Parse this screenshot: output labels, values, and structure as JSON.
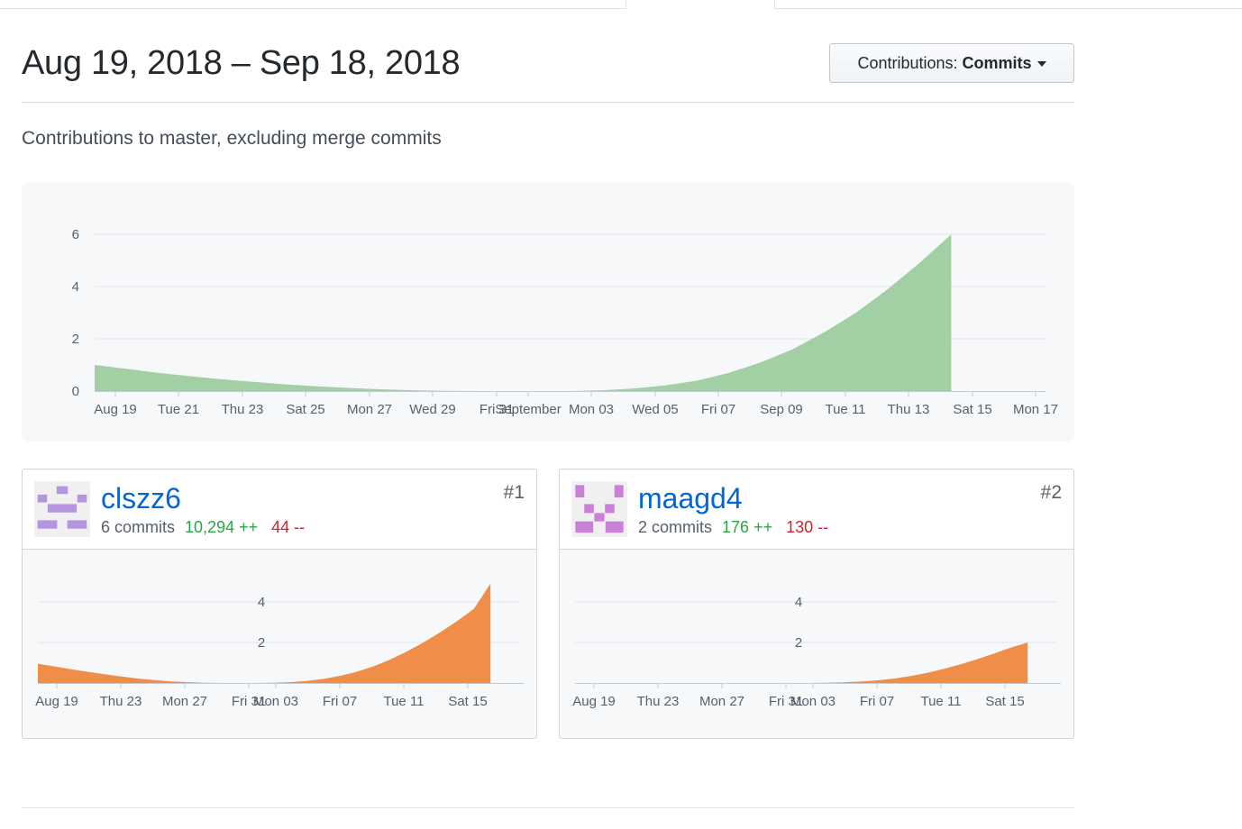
{
  "header": {
    "date_range": "Aug 19, 2018 – Sep 18, 2018",
    "contributions_label": "Contributions:",
    "contributions_value": "Commits"
  },
  "subtitle": "Contributions to master, excluding merge commits",
  "chart_data": [
    {
      "type": "area",
      "color": "#a2cfa4",
      "x_ticks": [
        "Aug 19",
        "Tue 21",
        "Thu 23",
        "Sat 25",
        "Mon 27",
        "Wed 29",
        "Fri 31",
        "September",
        "Mon 03",
        "Wed 05",
        "Fri 07",
        "Sep 09",
        "Tue 11",
        "Thu 13",
        "Sat 15",
        "Mon 17"
      ],
      "y_ticks": [
        0,
        2,
        4,
        6
      ],
      "ylim": [
        0,
        7
      ],
      "x": [
        "2018-08-19",
        "2018-08-20",
        "2018-08-21",
        "2018-08-22",
        "2018-08-23",
        "2018-08-24",
        "2018-08-25",
        "2018-08-26",
        "2018-08-27",
        "2018-08-28",
        "2018-08-29",
        "2018-08-30",
        "2018-08-31",
        "2018-09-01",
        "2018-09-02",
        "2018-09-03",
        "2018-09-04",
        "2018-09-05",
        "2018-09-06",
        "2018-09-07",
        "2018-09-08",
        "2018-09-09",
        "2018-09-10",
        "2018-09-11",
        "2018-09-12",
        "2018-09-13",
        "2018-09-14",
        "2018-09-15"
      ],
      "y": [
        1.0,
        0.85,
        0.7,
        0.57,
        0.45,
        0.35,
        0.26,
        0.18,
        0.12,
        0.07,
        0.03,
        0.01,
        0,
        0,
        0,
        0,
        0.03,
        0.1,
        0.22,
        0.4,
        0.7,
        1.1,
        1.6,
        2.25,
        3.0,
        3.9,
        4.9,
        6.0
      ],
      "grid": true
    },
    {
      "type": "area",
      "color": "#f08d49",
      "x_ticks": [
        "Aug 19",
        "Thu 23",
        "Mon 27",
        "Fri 31",
        "Mon 03",
        "Fri 07",
        "Tue 11",
        "Sat 15"
      ],
      "y_ticks": [
        2,
        4
      ],
      "ylim": [
        0,
        5
      ],
      "x": [
        "2018-08-19",
        "2018-08-20",
        "2018-08-21",
        "2018-08-22",
        "2018-08-23",
        "2018-08-24",
        "2018-08-25",
        "2018-08-26",
        "2018-08-27",
        "2018-08-28",
        "2018-08-29",
        "2018-08-30",
        "2018-08-31",
        "2018-09-01",
        "2018-09-02",
        "2018-09-03",
        "2018-09-04",
        "2018-09-05",
        "2018-09-06",
        "2018-09-07",
        "2018-09-08",
        "2018-09-09",
        "2018-09-10",
        "2018-09-11",
        "2018-09-12",
        "2018-09-13",
        "2018-09-14",
        "2018-09-15"
      ],
      "y": [
        0.95,
        0.82,
        0.68,
        0.55,
        0.43,
        0.32,
        0.22,
        0.14,
        0.08,
        0.04,
        0.01,
        0,
        0,
        0,
        0.01,
        0.04,
        0.1,
        0.2,
        0.35,
        0.55,
        0.82,
        1.15,
        1.55,
        2.0,
        2.5,
        3.05,
        3.65,
        4.9
      ],
      "grid": true
    },
    {
      "type": "area",
      "color": "#f08d49",
      "x_ticks": [
        "Aug 19",
        "Thu 23",
        "Mon 27",
        "Fri 31",
        "Mon 03",
        "Fri 07",
        "Tue 11",
        "Sat 15"
      ],
      "y_ticks": [
        2,
        4
      ],
      "ylim": [
        0,
        5
      ],
      "x": [
        "2018-08-19",
        "2018-08-20",
        "2018-08-21",
        "2018-08-22",
        "2018-08-23",
        "2018-08-24",
        "2018-08-25",
        "2018-08-26",
        "2018-08-27",
        "2018-08-28",
        "2018-08-29",
        "2018-08-30",
        "2018-08-31",
        "2018-09-01",
        "2018-09-02",
        "2018-09-03",
        "2018-09-04",
        "2018-09-05",
        "2018-09-06",
        "2018-09-07",
        "2018-09-08",
        "2018-09-09",
        "2018-09-10",
        "2018-09-11",
        "2018-09-12",
        "2018-09-13",
        "2018-09-14",
        "2018-09-15"
      ],
      "y": [
        0,
        0,
        0,
        0,
        0,
        0,
        0,
        0,
        0,
        0,
        0,
        0,
        0,
        0,
        0,
        0.01,
        0.03,
        0.07,
        0.13,
        0.22,
        0.34,
        0.5,
        0.7,
        0.92,
        1.18,
        1.46,
        1.75,
        2.0
      ],
      "grid": true
    }
  ],
  "contributors": [
    {
      "username": "clszz6",
      "commits": "6 commits",
      "additions": "10,294 ++",
      "deletions": "44 --",
      "rank": "#1",
      "avatar_color": "#b695e0"
    },
    {
      "username": "maagd4",
      "commits": "2 commits",
      "additions": "176 ++",
      "deletions": "130 --",
      "rank": "#2",
      "avatar_color": "#c980d6"
    }
  ]
}
